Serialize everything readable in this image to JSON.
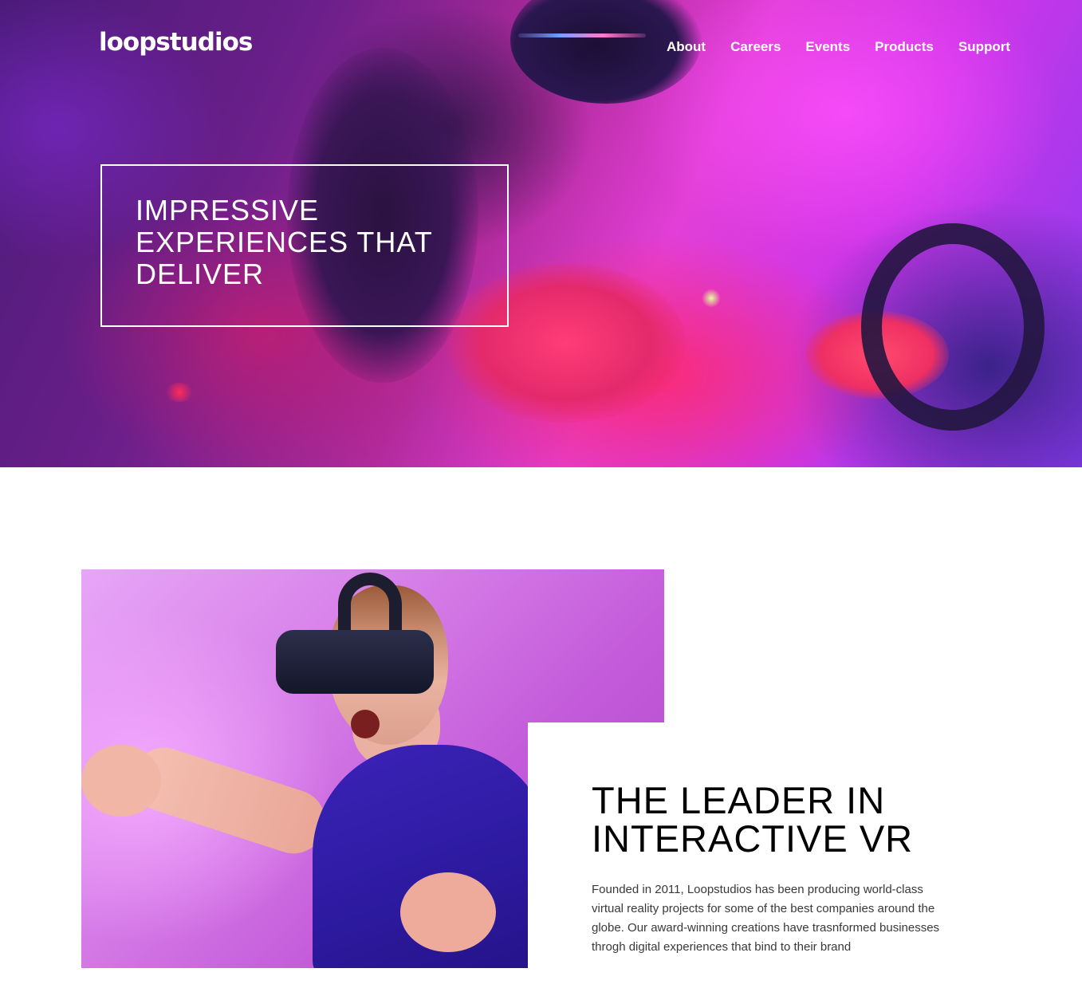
{
  "header": {
    "logo": "loopstudios",
    "nav": [
      {
        "label": "About"
      },
      {
        "label": "Careers"
      },
      {
        "label": "Events"
      },
      {
        "label": "Products"
      },
      {
        "label": "Support"
      }
    ]
  },
  "hero": {
    "heading": "Impressive experiences that deliver"
  },
  "interactive": {
    "heading": "The leader in interactive VR",
    "body": "Founded in 2011, Loopstudios has been producing world-class virtual reality projects for some of the best companies around the globe. Our award-winning creations have trasnformed businesses throgh digital experiences that bind to their brand"
  },
  "colors": {
    "text_dark": "#000000",
    "text_body": "#393939",
    "white": "#ffffff"
  }
}
